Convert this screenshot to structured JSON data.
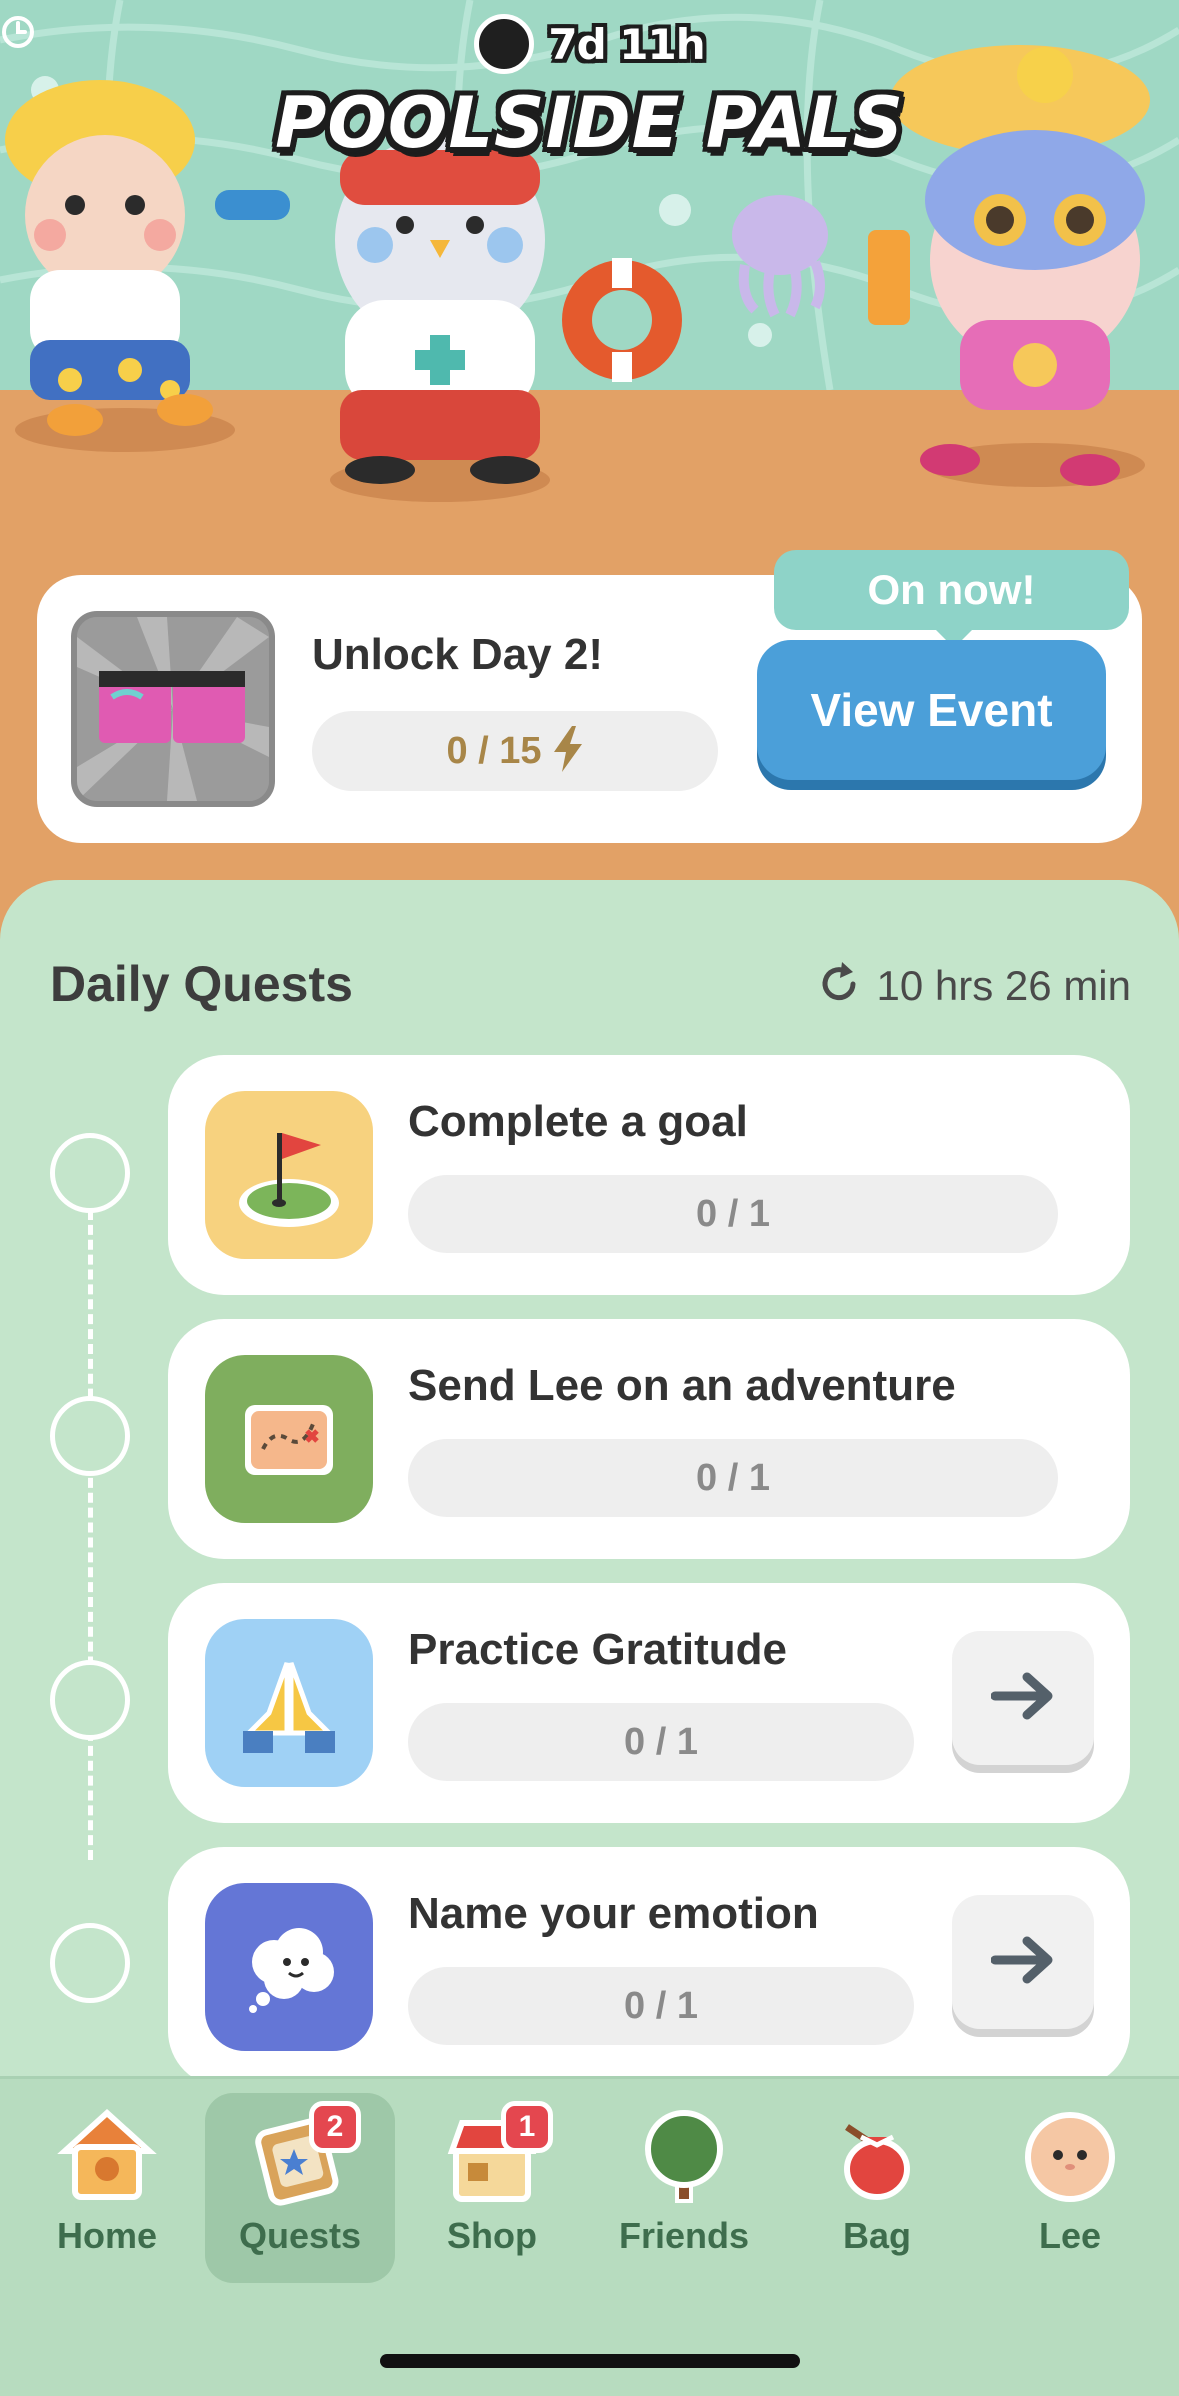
{
  "event": {
    "timer": "7d 11h",
    "title": "POOLSIDE PALS",
    "unlock_label": "Unlock Day 2!",
    "progress": "0 / 15",
    "on_now": "On now!",
    "view_button": "View Event"
  },
  "quests": {
    "heading": "Daily Quests",
    "refresh_time": "10 hrs 26 min",
    "items": [
      {
        "title": "Complete a goal",
        "progress": "0 / 1",
        "icon": "flag-icon",
        "color": "#f7d27f",
        "has_arrow": false
      },
      {
        "title": "Send Lee on an adventure",
        "progress": "0 / 1",
        "icon": "map-icon",
        "color": "#7fae5e",
        "has_arrow": false
      },
      {
        "title": "Practice Gratitude",
        "progress": "0 / 1",
        "icon": "praying-hands-icon",
        "color": "#9fd1f5",
        "has_arrow": true
      },
      {
        "title": "Name your emotion",
        "progress": "0 / 1",
        "icon": "cloud-face-icon",
        "color": "#6476d6",
        "has_arrow": true
      }
    ]
  },
  "nav": {
    "items": [
      {
        "label": "Home",
        "icon": "birdhouse-icon"
      },
      {
        "label": "Quests",
        "icon": "quest-board-icon",
        "badge": "2",
        "active": true
      },
      {
        "label": "Shop",
        "icon": "shop-icon",
        "badge": "1"
      },
      {
        "label": "Friends",
        "icon": "tree-icon"
      },
      {
        "label": "Bag",
        "icon": "bag-icon"
      },
      {
        "label": "Lee",
        "icon": "lee-avatar-icon"
      }
    ]
  },
  "colors": {
    "sand": "#e2a166",
    "pool": "#9fd8c4",
    "panel": "#c4e5cb",
    "accent_blue": "#4b9fd9",
    "teal": "#8ed3c8",
    "badge_red": "#e4474f"
  }
}
